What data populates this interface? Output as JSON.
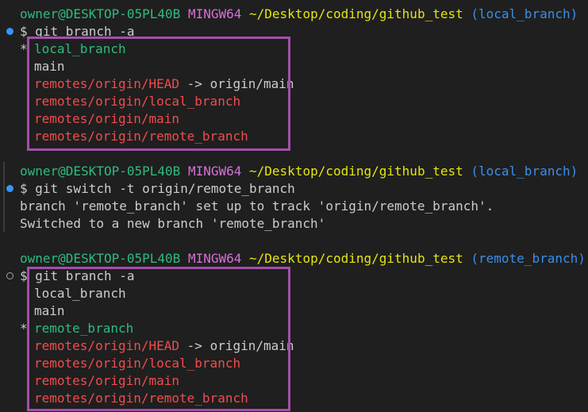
{
  "prompts": [
    {
      "user": "owner@DESKTOP-05PL40B",
      "shell": "MINGW64",
      "path": "~/Desktop/coding/github_test",
      "branch": "(local_branch)"
    },
    {
      "user": "owner@DESKTOP-05PL40B",
      "shell": "MINGW64",
      "path": "~/Desktop/coding/github_test",
      "branch": "(local_branch)"
    },
    {
      "user": "owner@DESKTOP-05PL40B",
      "shell": "MINGW64",
      "path": "~/Desktop/coding/github_test",
      "branch": "(remote_branch)"
    }
  ],
  "commands": [
    "$ git branch -a",
    "$ git switch -t origin/remote_branch",
    "$ git branch -a"
  ],
  "block1": {
    "star": "*",
    "current": "local_branch",
    "main": "main",
    "head_ref": "remotes/origin/HEAD",
    "head_arrow": " -> origin/main",
    "remote1": "remotes/origin/local_branch",
    "remote2": "remotes/origin/main",
    "remote3": "remotes/origin/remote_branch"
  },
  "switch_output": [
    "branch 'remote_branch' set up to track 'origin/remote_branch'.",
    "Switched to a new branch 'remote_branch'"
  ],
  "block2": {
    "local": "local_branch",
    "main": "main",
    "star": "*",
    "current": "remote_branch",
    "head_ref": "remotes/origin/HEAD",
    "head_arrow": " -> origin/main",
    "remote1": "remotes/origin/local_branch",
    "remote2": "remotes/origin/main",
    "remote3": "remotes/origin/remote_branch"
  },
  "colors": {
    "background": "#1f1f1f",
    "user": "#2ebb7f",
    "shell": "#d670d6",
    "path": "#e5e510",
    "branch": "#3b8eea",
    "remote": "#f14c4c",
    "highlight_box": "#a250a8",
    "decoration_success": "#3794ff"
  },
  "icons": {
    "command_success": "filled-circle-icon",
    "command_running": "hollow-circle-icon"
  }
}
